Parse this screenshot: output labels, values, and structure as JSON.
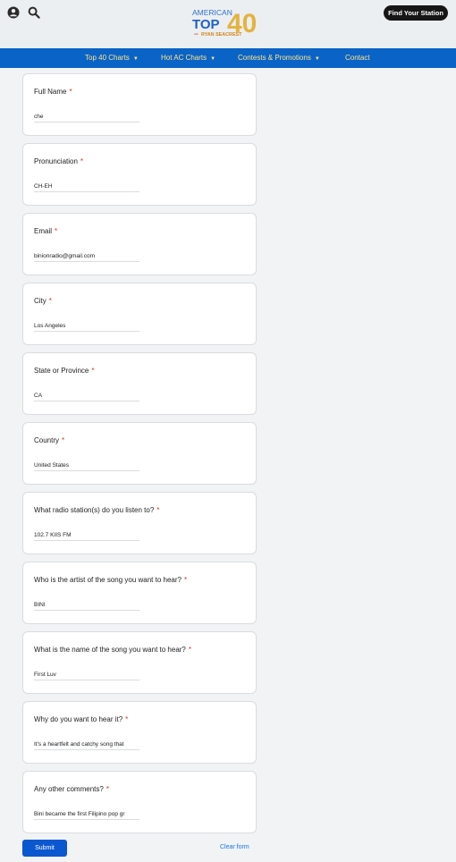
{
  "header": {
    "logo": {
      "line1": "AMERICAN",
      "line2": "TOP",
      "number": "40",
      "small": "with",
      "host": "RYAN SEACREST"
    },
    "find_station_label": "Find Your Station",
    "icons": [
      "user-icon",
      "search-icon"
    ]
  },
  "nav": {
    "items": [
      {
        "label": "Top 40 Charts",
        "dropdown": true
      },
      {
        "label": "Hot AC Charts",
        "dropdown": true
      },
      {
        "label": "Contests & Promotions",
        "dropdown": true
      },
      {
        "label": "Contact",
        "dropdown": false
      }
    ]
  },
  "form": {
    "questions": [
      {
        "label": "Full Name",
        "required_mark": "*",
        "value": "che"
      },
      {
        "label": "Pronunciation",
        "required_mark": "*",
        "value": "CH-EH"
      },
      {
        "label": "Email",
        "required_mark": "*",
        "value": "binionradio@gmail.com"
      },
      {
        "label": "City",
        "required_mark": "*",
        "value": "Los Angeles"
      },
      {
        "label": "State or Province",
        "required_mark": "*",
        "value": "CA"
      },
      {
        "label": "Country",
        "required_mark": "*",
        "value": "United States"
      },
      {
        "label": "What radio station(s) do you listen to?",
        "required_mark": "*",
        "value": "102.7 KIIS FM"
      },
      {
        "label": "Who is the artist of the song you want to hear?",
        "required_mark": "*",
        "value": "BINI"
      },
      {
        "label": "What is the name of the song you want to hear?",
        "required_mark": "*",
        "value": "First Luv"
      },
      {
        "label": "Why do you want to hear it?",
        "required_mark": "*",
        "value": "It's a heartfelt and catchy song that"
      },
      {
        "label": "Any other comments?",
        "required_mark": "*",
        "value": "Bini became the first Filipino pop gr"
      }
    ],
    "submit_label": "Submit",
    "clear_label": "Clear form"
  },
  "colors": {
    "nav_bg": "#0a63c6",
    "nav_text": "#ffe58a",
    "submit_bg": "#0b57d0",
    "required": "#d93025",
    "link": "#1a73e8"
  }
}
